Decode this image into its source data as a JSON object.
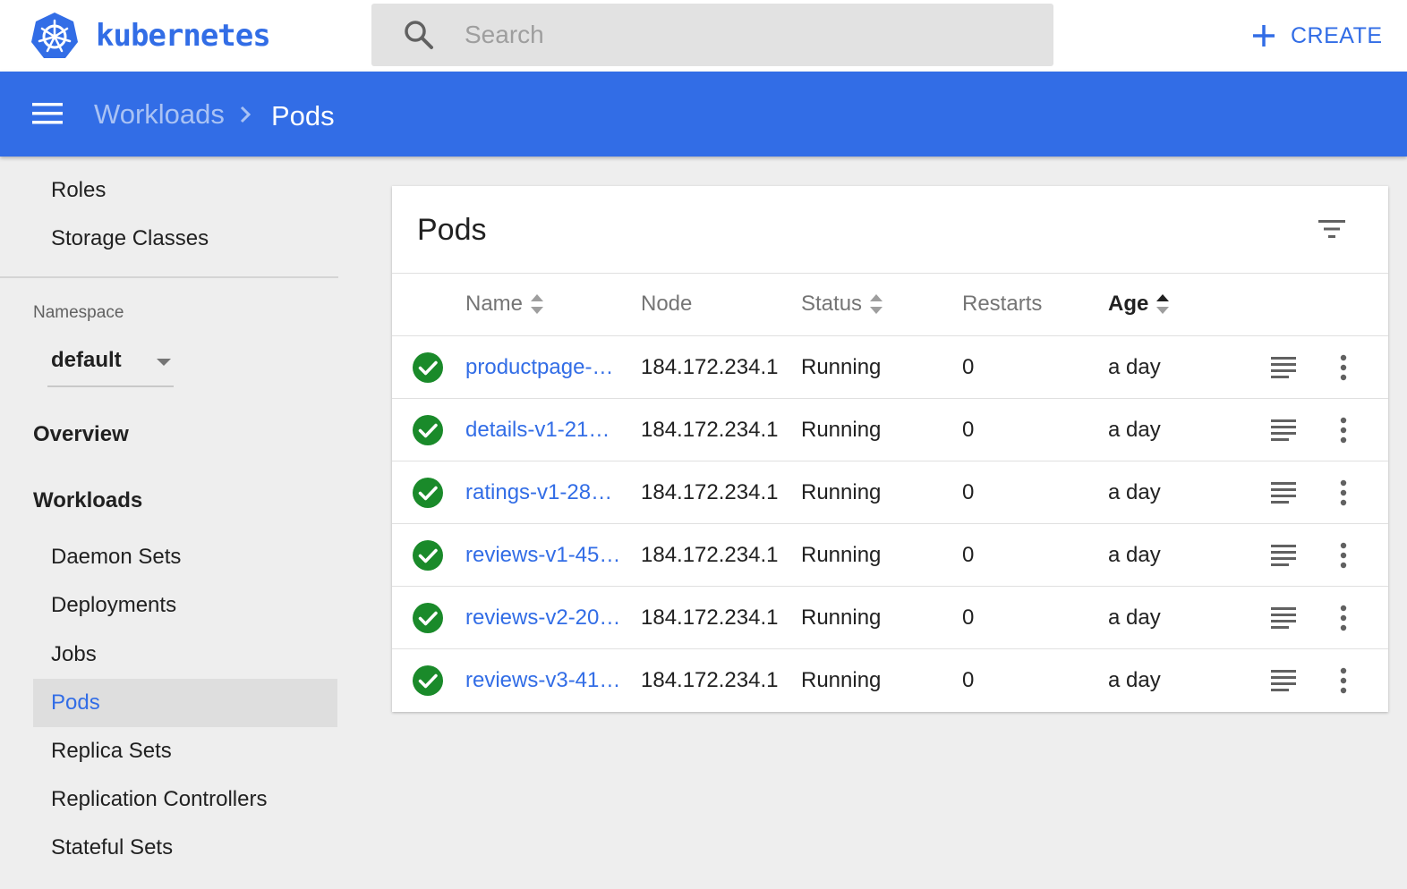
{
  "header": {
    "brand": "kubernetes",
    "search_placeholder": "Search",
    "create_label": "CREATE",
    "icons": {
      "logo": "kubernetes-wheel-icon",
      "search": "search-icon",
      "create": "plus-icon"
    }
  },
  "breadcrumb": {
    "parent": "Workloads",
    "current": "Pods"
  },
  "colors": {
    "brand_blue": "#326de6",
    "status_ok": "#1a8a2a",
    "background": "#eeeeee"
  },
  "sidebar": {
    "top_items": [
      "Roles",
      "Storage Classes"
    ],
    "namespace_label": "Namespace",
    "namespace_value": "default",
    "overview_label": "Overview",
    "workloads_label": "Workloads",
    "workload_items": [
      "Daemon Sets",
      "Deployments",
      "Jobs",
      "Pods",
      "Replica Sets",
      "Replication Controllers",
      "Stateful Sets"
    ],
    "active_item": "Pods"
  },
  "pods_card": {
    "title": "Pods",
    "columns": [
      "Name",
      "Node",
      "Status",
      "Restarts",
      "Age"
    ],
    "sorted_column": "Age",
    "rows": [
      {
        "name": "productpage-…",
        "node": "184.172.234.1",
        "status": "Running",
        "restarts": "0",
        "age": "a day"
      },
      {
        "name": "details-v1-21…",
        "node": "184.172.234.1",
        "status": "Running",
        "restarts": "0",
        "age": "a day"
      },
      {
        "name": "ratings-v1-28…",
        "node": "184.172.234.1",
        "status": "Running",
        "restarts": "0",
        "age": "a day"
      },
      {
        "name": "reviews-v1-45…",
        "node": "184.172.234.1",
        "status": "Running",
        "restarts": "0",
        "age": "a day"
      },
      {
        "name": "reviews-v2-20…",
        "node": "184.172.234.1",
        "status": "Running",
        "restarts": "0",
        "age": "a day"
      },
      {
        "name": "reviews-v3-41…",
        "node": "184.172.234.1",
        "status": "Running",
        "restarts": "0",
        "age": "a day"
      }
    ]
  }
}
